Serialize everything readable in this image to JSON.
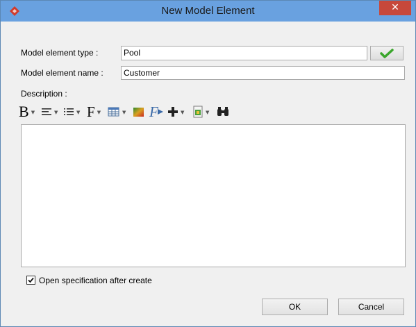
{
  "window": {
    "title": "New Model Element",
    "close_glyph": "✕"
  },
  "form": {
    "type_label": "Model element type :",
    "type_value": "Pool",
    "name_label": "Model element name :",
    "name_value": "Customer",
    "description_label": "Description :"
  },
  "toolbar": {
    "tools": [
      {
        "icon": "bold-icon",
        "glyph": "B"
      },
      {
        "icon": "align-icon"
      },
      {
        "icon": "list-icon"
      },
      {
        "icon": "font-icon",
        "glyph": "F"
      },
      {
        "icon": "table-icon"
      },
      {
        "icon": "color-icon"
      },
      {
        "icon": "format-icon",
        "glyph": "F"
      },
      {
        "icon": "insert-icon"
      },
      {
        "icon": "paste-icon"
      },
      {
        "icon": "find-icon"
      }
    ],
    "dropdown_glyph": "▼"
  },
  "options": {
    "open_spec_label": "Open specification after create",
    "open_spec_checked": true,
    "check_glyph": "✓"
  },
  "buttons": {
    "ok": "OK",
    "cancel": "Cancel"
  },
  "colors": {
    "titlebar": "#69a1e0",
    "close": "#c7483b",
    "accept_check": "#3aa62b"
  }
}
